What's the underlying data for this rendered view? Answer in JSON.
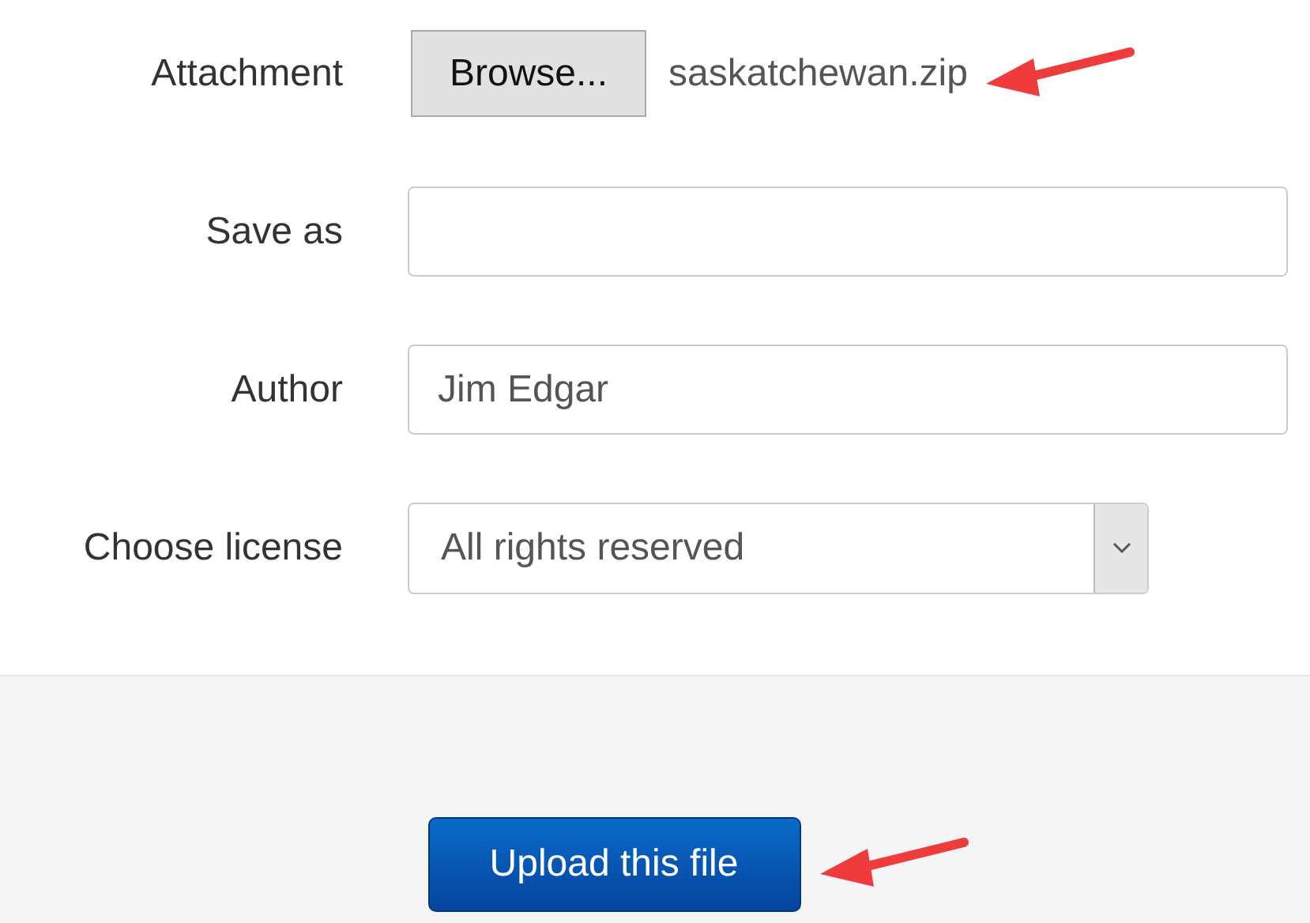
{
  "fields": [
    {
      "kind": "file",
      "label": "Attachment",
      "button": "Browse...",
      "value": "saskatchewan.zip"
    },
    {
      "kind": "text",
      "label": "Save as"
    },
    {
      "kind": "text",
      "label": "Author",
      "value": "Jim Edgar"
    },
    {
      "kind": "select",
      "label": "Choose license",
      "value": "All rights reserved"
    }
  ],
  "submit": "Upload this file"
}
